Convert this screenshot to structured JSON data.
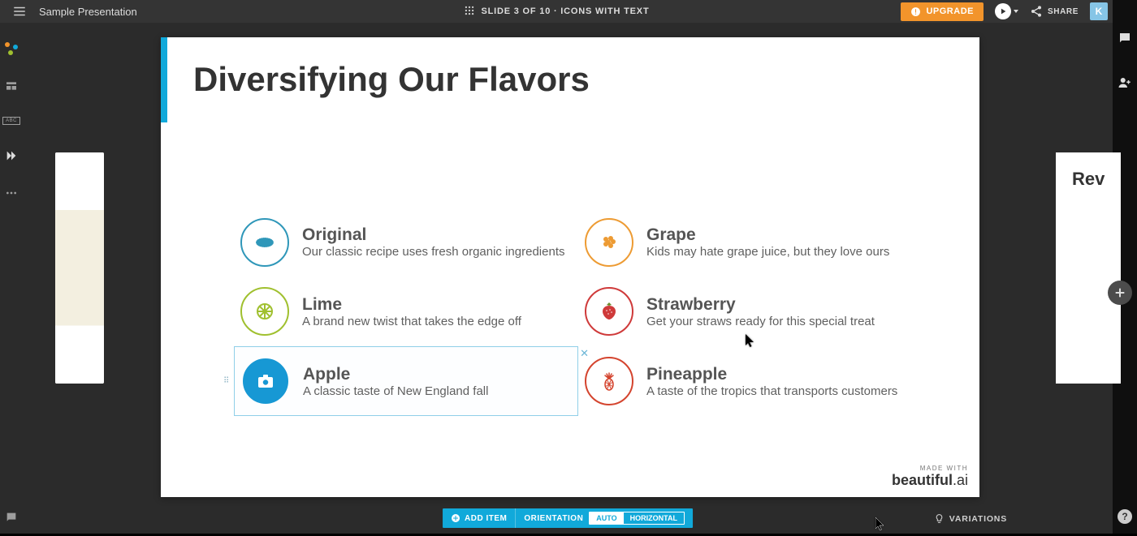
{
  "header": {
    "presentation_title": "Sample Presentation",
    "slide_info": "SLIDE 3 OF 10 · ICONS WITH TEXT",
    "upgrade_label": "UPGRADE",
    "share_label": "SHARE",
    "avatar_initial": "K"
  },
  "left_rail": {
    "abc_label": "ABC"
  },
  "slide": {
    "title": "Diversifying Our Flavors",
    "items": [
      {
        "title": "Original",
        "desc": "Our classic recipe uses fresh organic ingredients",
        "color": "original"
      },
      {
        "title": "Grape",
        "desc": "Kids may hate grape juice, but they love ours",
        "color": "grape"
      },
      {
        "title": "Lime",
        "desc": "A brand new twist that takes the edge off",
        "color": "lime"
      },
      {
        "title": "Strawberry",
        "desc": "Get your straws ready for this special treat",
        "color": "strawberry"
      },
      {
        "title": "Apple",
        "desc": "A classic taste of New England fall",
        "color": "apple",
        "selected": true
      },
      {
        "title": "Pineapple",
        "desc": "A taste of the tropics that transports customers",
        "color": "pineapple"
      }
    ],
    "made_with_small": "MADE WITH",
    "made_with_brand_strong": "beautiful",
    "made_with_brand_rest": ".ai"
  },
  "toolbar": {
    "add_item_label": "ADD ITEM",
    "orientation_label": "ORIENTATION",
    "orientation_options": {
      "auto": "AUTO",
      "horizontal": "HORIZONTAL"
    }
  },
  "footer": {
    "variations_label": "VARIATIONS"
  },
  "next_thumb_title": "Rev"
}
